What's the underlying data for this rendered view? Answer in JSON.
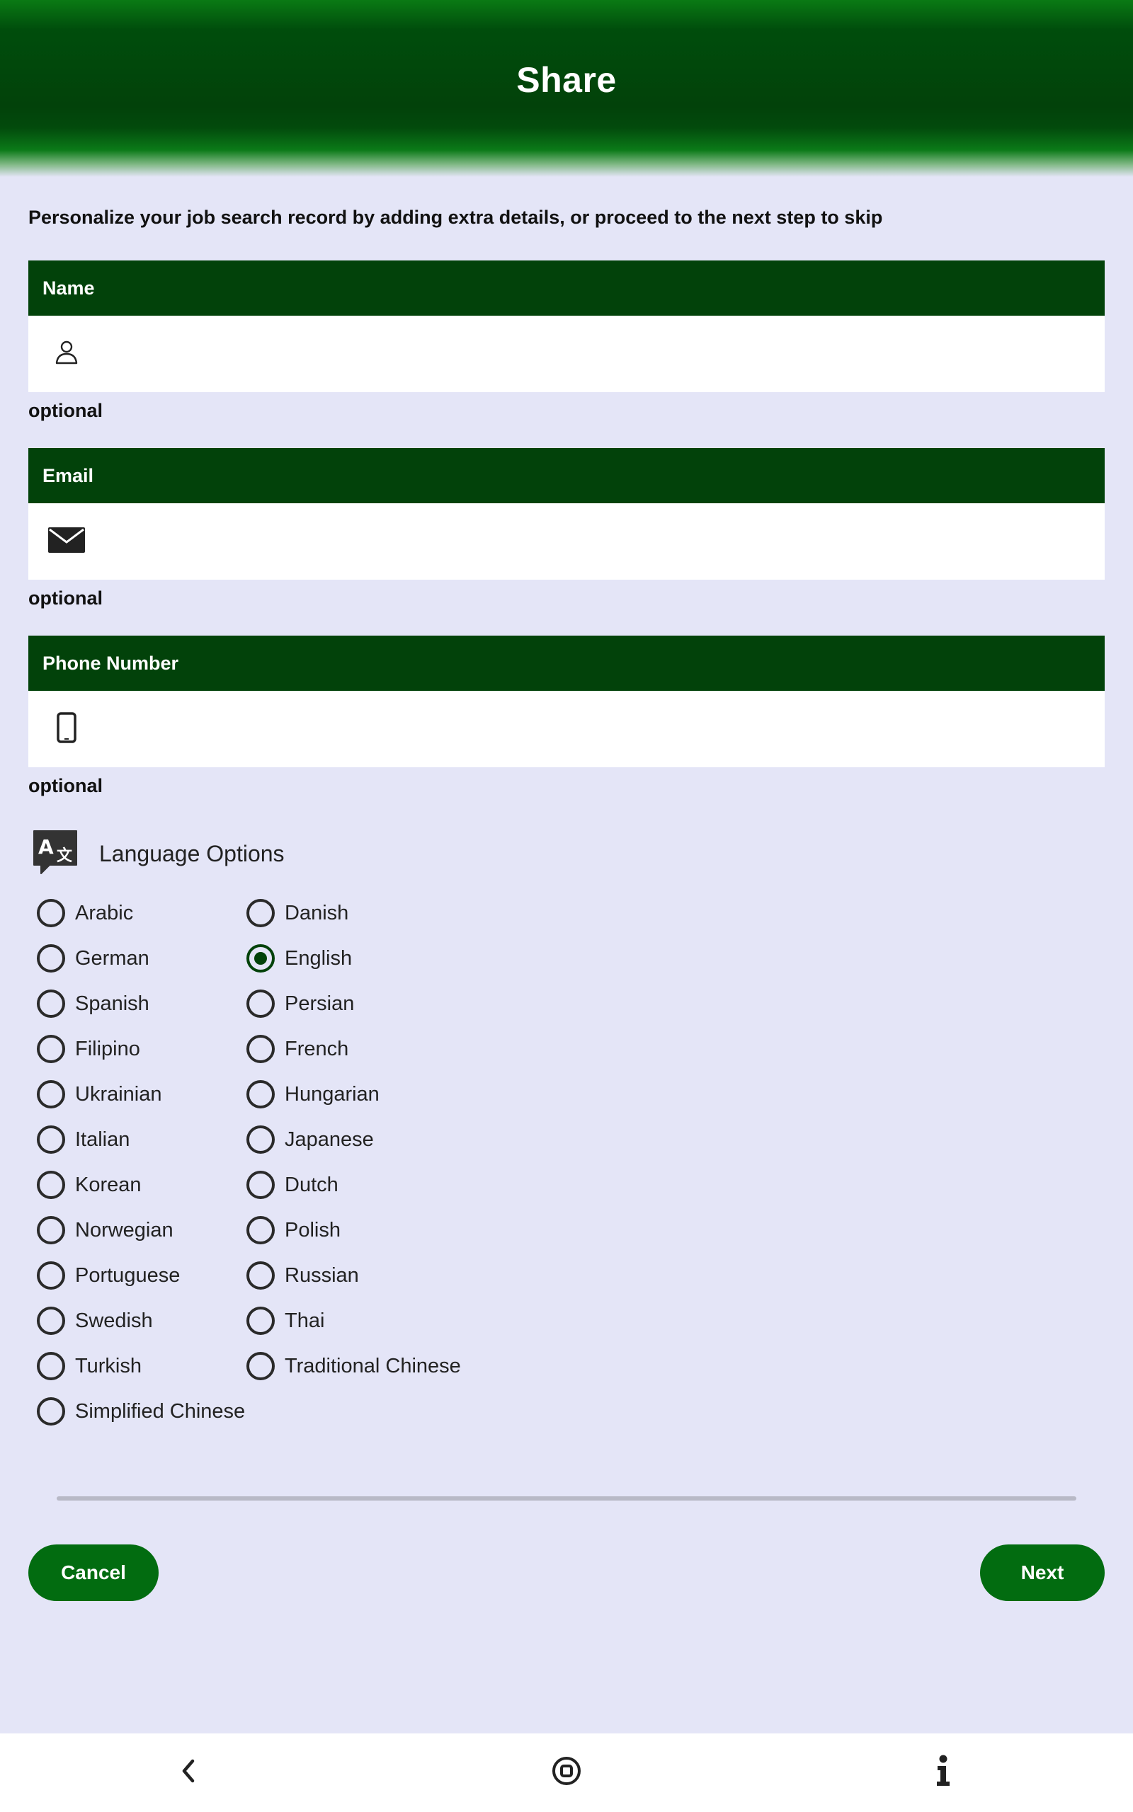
{
  "header": {
    "title": "Share"
  },
  "intro": "Personalize your job search record by adding extra details, or proceed to the next step to skip",
  "fields": [
    {
      "label": "Name",
      "icon": "person-icon",
      "value": "",
      "hint": "optional"
    },
    {
      "label": "Email",
      "icon": "mail-icon",
      "value": "",
      "hint": "optional"
    },
    {
      "label": "Phone Number",
      "icon": "phone-icon",
      "value": "",
      "hint": "optional"
    }
  ],
  "language": {
    "title": "Language Options",
    "icon": "translate-icon",
    "selected": "English",
    "options": [
      "Arabic",
      "Danish",
      "German",
      "English",
      "Spanish",
      "Persian",
      "Filipino",
      "French",
      "Ukrainian",
      "Hungarian",
      "Italian",
      "Japanese",
      "Korean",
      "Dutch",
      "Norwegian",
      "Polish",
      "Portuguese",
      "Russian",
      "Swedish",
      "Thai",
      "Turkish",
      "Traditional Chinese",
      "Simplified Chinese"
    ]
  },
  "buttons": {
    "cancel": "Cancel",
    "next": "Next"
  },
  "nav": {
    "back_icon": "back-chevron-icon",
    "home_icon": "home-icon",
    "info_icon": "info-icon"
  },
  "colors": {
    "brand_dark": "#02420a",
    "button": "#026c10",
    "background": "#e4e5f7"
  }
}
